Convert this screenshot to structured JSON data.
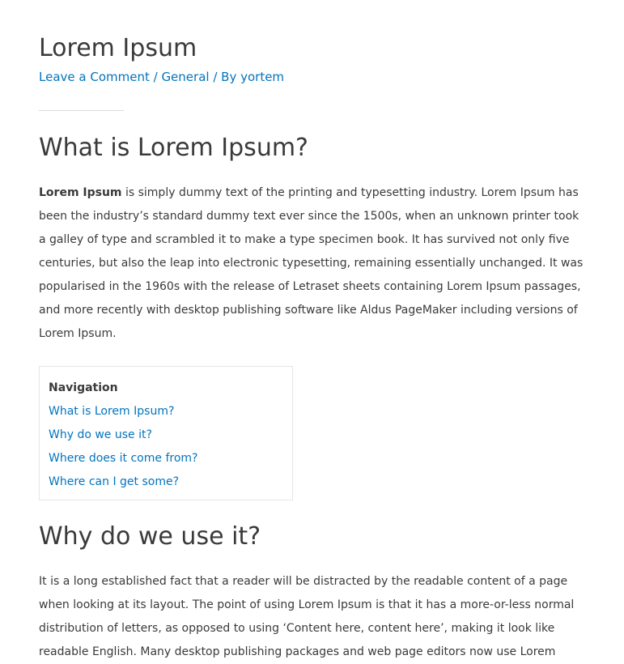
{
  "post": {
    "title": "Lorem Ipsum",
    "meta": {
      "comment_link": "Leave a Comment",
      "separator": " / ",
      "category": "General",
      "by_prefix": " / By ",
      "author": "yortem"
    }
  },
  "section1": {
    "heading": "What is Lorem Ipsum?",
    "bold_lead": "Lorem Ipsum",
    "body": " is simply dummy text of the printing and typesetting industry. Lorem Ipsum has been the industry’s standard dummy text ever since the 1500s, when an unknown printer took a galley of type and scrambled it to make a type specimen book. It has survived not only five centuries, but also the leap into electronic typesetting, remaining essentially unchanged. It was popularised in the 1960s with the release of Letraset sheets containing Lorem Ipsum passages, and more recently with desktop publishing software like Aldus PageMaker including versions of Lorem Ipsum."
  },
  "toc": {
    "heading": "Navigation",
    "items": [
      {
        "label": "What is Lorem Ipsum?"
      },
      {
        "label": "Why do we use it?"
      },
      {
        "label": "Where does it come from?"
      },
      {
        "label": "Where can I get some?"
      }
    ]
  },
  "section2": {
    "heading": "Why do we use it?",
    "body": "It is a long established fact that a reader will be distracted by the readable content of a page when looking at its layout. The point of using Lorem Ipsum is that it has a more-or-less normal distribution of letters, as opposed to using ‘Content here, content here’, making it look like readable English. Many desktop publishing packages and web page editors now use Lorem"
  },
  "colors": {
    "link": "#0274be",
    "text": "#3a3a3a",
    "border": "#e5e5e5"
  }
}
